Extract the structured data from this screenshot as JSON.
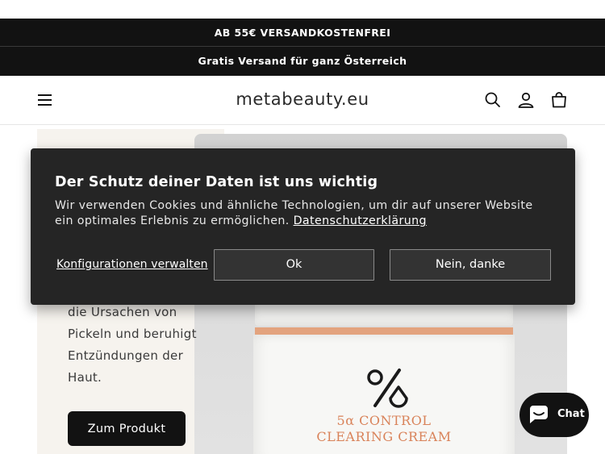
{
  "announcements": [
    "AB 55€ VERSANDKOSTENFREI",
    "Gratis Versand für ganz Österreich"
  ],
  "header": {
    "logo": "metabeauty.eu",
    "icons": [
      "menu-icon",
      "search-icon",
      "account-icon",
      "cart-icon"
    ]
  },
  "hero": {
    "text": "die Ursachen von Pickeln und beruhigt Entzündungen der Haut.",
    "button": "Zum Produkt",
    "product_label_line1": "5α CONTROL",
    "product_label_line2": "CLEARING CREAM"
  },
  "cookie_banner": {
    "title": "Der Schutz deiner Daten ist uns wichtig",
    "body": "Wir verwenden Cookies und ähnliche Technologien, um dir auf unserer Website ein optimales Erlebnis zu ermöglichen.",
    "link": "Datenschutzerklärung",
    "configure": "Konfigurationen verwalten",
    "accept": "Ok",
    "decline": "Nein, danke"
  },
  "chat": {
    "label": "Chat"
  },
  "colors": {
    "dark": "#121212",
    "banner_bg": "#252525",
    "hero_bg": "#f6f3ee",
    "product_accent": "#d9835a"
  }
}
